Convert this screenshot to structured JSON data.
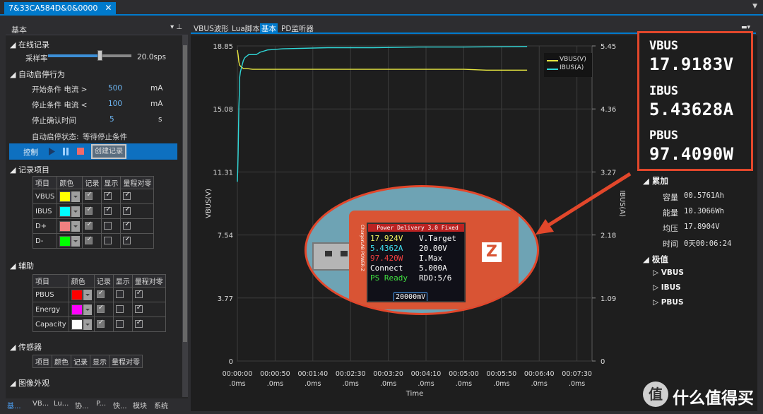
{
  "window": {
    "tab_title": "7&33CA584D&0&0000",
    "close_glyph": "✕"
  },
  "left_panel": {
    "title": "基本",
    "online": {
      "section": "在线记录",
      "sample_rate_label": "采样率",
      "sample_rate_value": "20.0sps",
      "sample_rate_level": 0.62
    },
    "auto": {
      "section": "自动启停行为",
      "start_label": "开始条件 电流 >",
      "start_value": "500",
      "start_unit": "mA",
      "stop_label": "停止条件 电流 <",
      "stop_value": "100",
      "stop_unit": "mA",
      "confirm_label": "停止确认时间",
      "confirm_value": "5",
      "confirm_unit": "s",
      "status_label": "自动启停状态:",
      "status_value": "等待停止条件"
    },
    "control": {
      "label": "控制",
      "create_label": "创建记录"
    },
    "record_items": {
      "section": "记录项目",
      "headers": [
        "项目",
        "颜色",
        "记录",
        "显示",
        "量程对零"
      ],
      "rows": [
        {
          "name": "VBUS",
          "color": "#ffff00",
          "record": true,
          "show": true,
          "zero": true
        },
        {
          "name": "IBUS",
          "color": "#00ffff",
          "record": true,
          "show": true,
          "zero": true
        },
        {
          "name": "D+",
          "color": "#f08080",
          "record": true,
          "show": false,
          "zero": true
        },
        {
          "name": "D-",
          "color": "#00ff00",
          "record": true,
          "show": false,
          "zero": true
        }
      ]
    },
    "aux": {
      "section": "辅助",
      "headers": [
        "项目",
        "颜色",
        "记录",
        "显示",
        "量程对零"
      ],
      "rows": [
        {
          "name": "PBUS",
          "color": "#ff0000",
          "record": true,
          "show": false,
          "zero": true
        },
        {
          "name": "Energy",
          "color": "#ff00ff",
          "record": true,
          "show": false,
          "zero": true
        },
        {
          "name": "Capacity",
          "color": "#ffffff",
          "record": true,
          "show": false,
          "zero": true
        }
      ]
    },
    "sensor": {
      "section": "传感器",
      "headers": [
        "项目",
        "颜色",
        "记录",
        "显示",
        "量程对零"
      ]
    },
    "appearance": {
      "section": "图像外观"
    },
    "bottom_tabs": [
      "基...",
      "VB...",
      "Lu...",
      "协...",
      "P...",
      "快...",
      "模块",
      "系统"
    ]
  },
  "doc_tabs": [
    "VBUS波形",
    "Lua脚本",
    "基本",
    "PD监听器"
  ],
  "readout": {
    "vbus_label": "VBUS",
    "vbus_value": "17.9183V",
    "ibus_label": "IBUS",
    "ibus_value": "5.43628A",
    "pbus_label": "PBUS",
    "pbus_value": "97.4090W"
  },
  "accumulate": {
    "section": "累加",
    "capacity_label": "容量",
    "capacity_value": "00.5761Ah",
    "energy_label": "能量",
    "energy_value": "10.3066Wh",
    "avgv_label": "均压",
    "avgv_value": "17.8904V",
    "time_label": "时间",
    "time_value": "0天00:06:24"
  },
  "extreme": {
    "section": "极值",
    "items": [
      "VBUS",
      "IBUS",
      "PBUS"
    ]
  },
  "meter_photo": {
    "header": "Power Delivery 3.0 Fixed",
    "lines": [
      {
        "left": "17.924V",
        "right": "V.Target",
        "color": "#f0f060"
      },
      {
        "left": "5.4362A",
        "right": "20.00V",
        "color": "#40e0f0"
      },
      {
        "left": "97.420W",
        "right": "I.Max",
        "color": "#f04040"
      },
      {
        "left": "Connect",
        "right": "5.000A",
        "color": "#ffffff"
      },
      {
        "left": "PS Ready",
        "right": "RDO:5/6",
        "color": "#40e040"
      }
    ],
    "set_value": "20000",
    "set_unit": "mV",
    "logo": "Z",
    "brand": "ChargerLAB POWER-Z"
  },
  "watermark": {
    "logo": "值",
    "text": "什么值得买"
  },
  "chart_data": {
    "type": "line",
    "x_ticks": [
      "00:00:00\n.0ms",
      "00:00:50\n.0ms",
      "00:01:40\n.0ms",
      "00:02:30\n.0ms",
      "00:03:20\n.0ms",
      "00:04:10\n.0ms",
      "00:05:00\n.0ms",
      "00:05:50\n.0ms",
      "00:06:40\n.0ms",
      "00:07:30\n.0ms"
    ],
    "xlabel": "Time",
    "ylabel_left": "VBUS(V)",
    "ylabel_right": "IBUS(A)",
    "y_left_ticks": [
      "18.85",
      "15.08",
      "11.31",
      "7.54",
      "3.77",
      "0"
    ],
    "y_right_ticks": [
      "5.45",
      "4.36",
      "3.27",
      "2.18",
      "1.09",
      "0"
    ],
    "ylim_left": [
      0,
      18.85
    ],
    "ylim_right": [
      0,
      5.45
    ],
    "xlim_seconds": [
      0,
      470
    ],
    "legend_position": "top-right",
    "grid": true,
    "series": [
      {
        "name": "VBUS(V)",
        "axis": "left",
        "color": "#e6e640",
        "x": [
          0,
          1,
          2,
          3,
          5,
          8,
          12,
          20,
          30,
          60,
          120,
          180,
          240,
          300,
          330,
          384
        ],
        "y": [
          18.6,
          18.3,
          17.9,
          17.7,
          17.6,
          17.5,
          17.5,
          17.45,
          17.45,
          17.45,
          17.45,
          17.45,
          17.45,
          17.45,
          17.4,
          17.4
        ]
      },
      {
        "name": "IBUS(A)",
        "axis": "right",
        "color": "#30d8d8",
        "x": [
          0,
          0.5,
          1,
          1.5,
          2,
          2.5,
          3,
          4,
          5,
          6,
          8,
          10,
          15,
          20,
          25,
          30,
          40,
          60,
          120,
          180,
          240,
          300,
          384
        ],
        "y": [
          3.1,
          3.3,
          3.6,
          4.0,
          4.4,
          4.6,
          4.9,
          5.0,
          5.05,
          5.1,
          5.2,
          5.25,
          5.3,
          5.3,
          5.3,
          5.34,
          5.38,
          5.4,
          5.42,
          5.42,
          5.43,
          5.43,
          5.44
        ]
      }
    ]
  }
}
